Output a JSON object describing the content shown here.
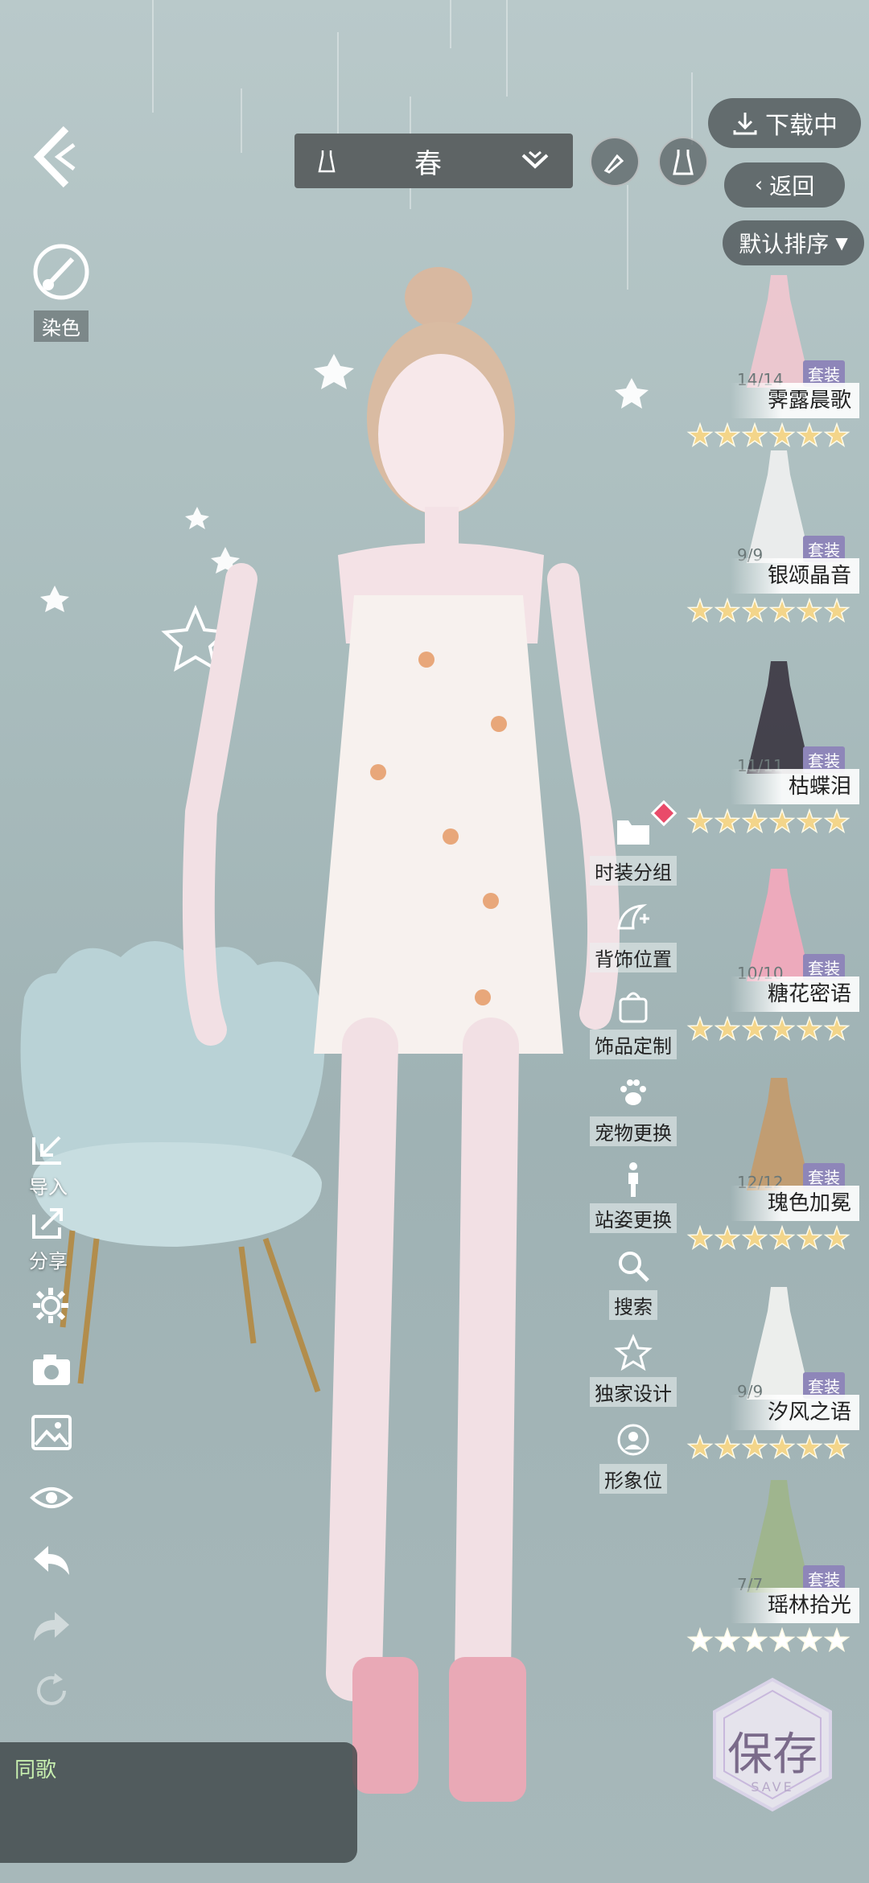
{
  "top": {
    "season_label": "春",
    "download_label": "下载中",
    "return_label": "返回",
    "sort_label": "默认排序"
  },
  "left_toolbar": {
    "dye_label": "染色",
    "import_label": "导入",
    "share_label": "分享"
  },
  "menu": [
    {
      "label": "时装分组",
      "icon": "folder-icon"
    },
    {
      "label": "背饰位置",
      "icon": "wing-move-icon"
    },
    {
      "label": "饰品定制",
      "icon": "accessory-bag-icon"
    },
    {
      "label": "宠物更换",
      "icon": "paw-icon"
    },
    {
      "label": "站姿更换",
      "icon": "person-icon"
    },
    {
      "label": "搜索",
      "icon": "search-icon"
    },
    {
      "label": "独家设计",
      "icon": "star-icon"
    },
    {
      "label": "形象位",
      "icon": "avatar-slot-icon"
    }
  ],
  "outfits": [
    {
      "name": "霁露晨歌",
      "count": "14/14",
      "tag": "套装",
      "stars": 6,
      "color": "#f2c8d0"
    },
    {
      "name": "银颂晶音",
      "count": "9/9",
      "tag": "套装",
      "stars": 6,
      "color": "#f1f1f1"
    },
    {
      "name": "枯蝶泪",
      "count": "11/11",
      "tag": "套装",
      "stars": 6,
      "color": "#3a3540"
    },
    {
      "name": "糖花密语",
      "count": "10/10",
      "tag": "套装",
      "stars": 6,
      "color": "#f5a9bd"
    },
    {
      "name": "瑰色加冕",
      "count": "12/12",
      "tag": "套装",
      "stars": 6,
      "color": "#c49a6a"
    },
    {
      "name": "汐风之语",
      "count": "9/9",
      "tag": "套装",
      "stars": 6,
      "color": "#f4f4f2"
    },
    {
      "name": "瑶林拾光",
      "count": "7/7",
      "tag": "套装",
      "stars": 6,
      "color": "#9fb58a"
    }
  ],
  "save_label": "保存",
  "save_sub": "SAVE",
  "chat_text": "同歌",
  "colors": {
    "accent_gold": "#f3d58a",
    "panel": "#5e6465"
  }
}
